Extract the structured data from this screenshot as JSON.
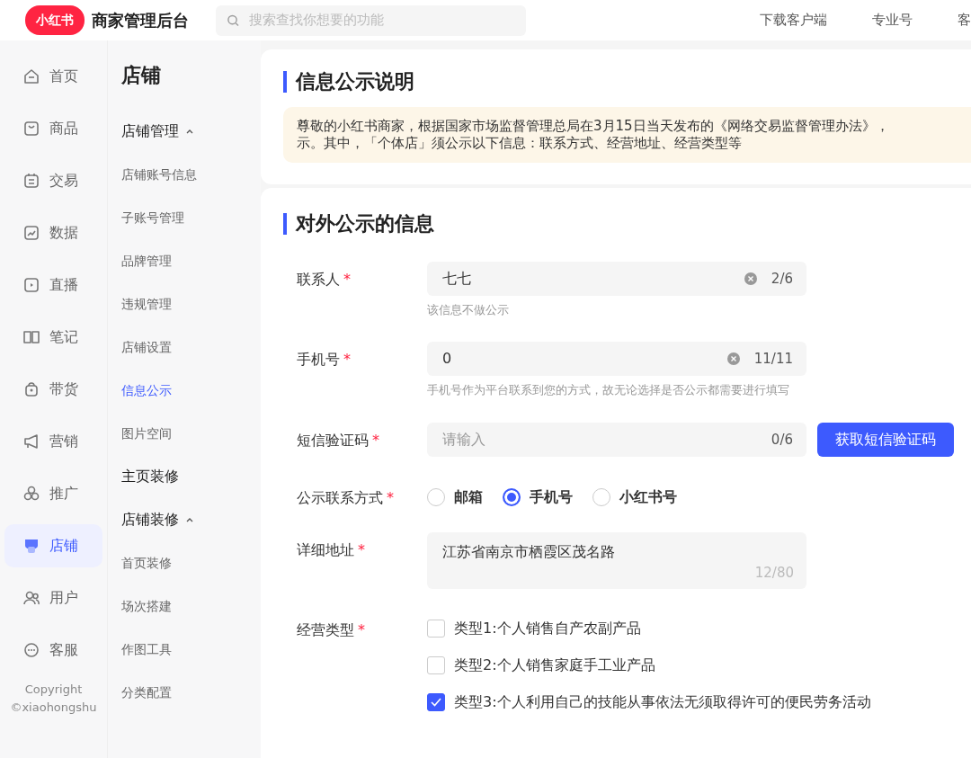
{
  "header": {
    "logo": "小红书",
    "title": "商家管理后台",
    "search": {
      "placeholder": "搜索查找你想要的功能"
    },
    "links": [
      "下载客户端",
      "专业号",
      "客"
    ]
  },
  "nav": {
    "items": [
      {
        "label": "首页",
        "selected": false
      },
      {
        "label": "商品",
        "selected": false
      },
      {
        "label": "交易",
        "selected": false
      },
      {
        "label": "数据",
        "selected": false
      },
      {
        "label": "直播",
        "selected": false
      },
      {
        "label": "笔记",
        "selected": false
      },
      {
        "label": "带货",
        "selected": false
      },
      {
        "label": "营销",
        "selected": false
      },
      {
        "label": "推广",
        "selected": false
      },
      {
        "label": "店铺",
        "selected": true
      },
      {
        "label": "用户",
        "selected": false
      },
      {
        "label": "客服",
        "selected": false
      }
    ],
    "copyright": [
      "Copyright",
      "©xiaohongshu"
    ]
  },
  "subnav": {
    "title": "店铺",
    "items": [
      {
        "kind": "group",
        "label": "店铺管理",
        "expanded": true
      },
      {
        "kind": "item",
        "label": "店铺账号信息",
        "selected": false
      },
      {
        "kind": "item",
        "label": "子账号管理",
        "selected": false
      },
      {
        "kind": "item",
        "label": "品牌管理",
        "selected": false
      },
      {
        "kind": "item",
        "label": "违规管理",
        "selected": false
      },
      {
        "kind": "item",
        "label": "店铺设置",
        "selected": false
      },
      {
        "kind": "item",
        "label": "信息公示",
        "selected": true
      },
      {
        "kind": "item",
        "label": "图片空间",
        "selected": false
      },
      {
        "kind": "heading",
        "label": "主页装修"
      },
      {
        "kind": "group",
        "label": "店铺装修",
        "expanded": true
      },
      {
        "kind": "item",
        "label": "首页装修",
        "selected": false
      },
      {
        "kind": "item",
        "label": "场次搭建",
        "selected": false
      },
      {
        "kind": "item",
        "label": "作图工具",
        "selected": false
      },
      {
        "kind": "item",
        "label": "分类配置",
        "selected": false
      }
    ]
  },
  "notice_card": {
    "title": "信息公示说明",
    "lines": [
      "尊敬的小红书商家，根据国家市场监督管理总局在3月15日当天发布的《网络交易监督管理办法》，",
      "示。其中，「个体店」须公示以下信息：联系方式、经营地址、经营类型等"
    ]
  },
  "form_card": {
    "title": "对外公示的信息",
    "rows": [
      {
        "kind": "input",
        "label": "联系人",
        "required_mark": "*",
        "value": "七七",
        "clearable": true,
        "counter": "2/6",
        "hint": "该信息不做公示"
      },
      {
        "kind": "input",
        "label": "手机号",
        "required_mark": "*",
        "value": "0",
        "clearable": true,
        "counter": "11/11",
        "hint": "手机号作为平台联系到您的方式，故无论选择是否公示都需要进行填写"
      },
      {
        "kind": "input-button",
        "label": "短信验证码",
        "required_mark": "*",
        "placeholder": "请输入",
        "counter": "0/6",
        "button": "获取短信验证码"
      },
      {
        "kind": "radio",
        "label": "公示联系方式",
        "required_mark": "*",
        "options": [
          {
            "label": "邮箱",
            "selected": false
          },
          {
            "label": "手机号",
            "selected": true
          },
          {
            "label": "小红书号",
            "selected": false
          }
        ]
      },
      {
        "kind": "textarea",
        "label": "详细地址",
        "required_mark": "*",
        "value": "江苏省南京市栖霞区茂名路",
        "counter": "12/80"
      },
      {
        "kind": "checkbox",
        "label": "经营类型",
        "required_mark": "*",
        "options": [
          {
            "label": "类型1:个人销售自产农副产品",
            "checked": false
          },
          {
            "label": "类型2:个人销售家庭手工业产品",
            "checked": false
          },
          {
            "label": "类型3:个人利用自己的技能从事依法无须取得许可的便民劳务活动",
            "checked": true
          }
        ]
      }
    ]
  }
}
